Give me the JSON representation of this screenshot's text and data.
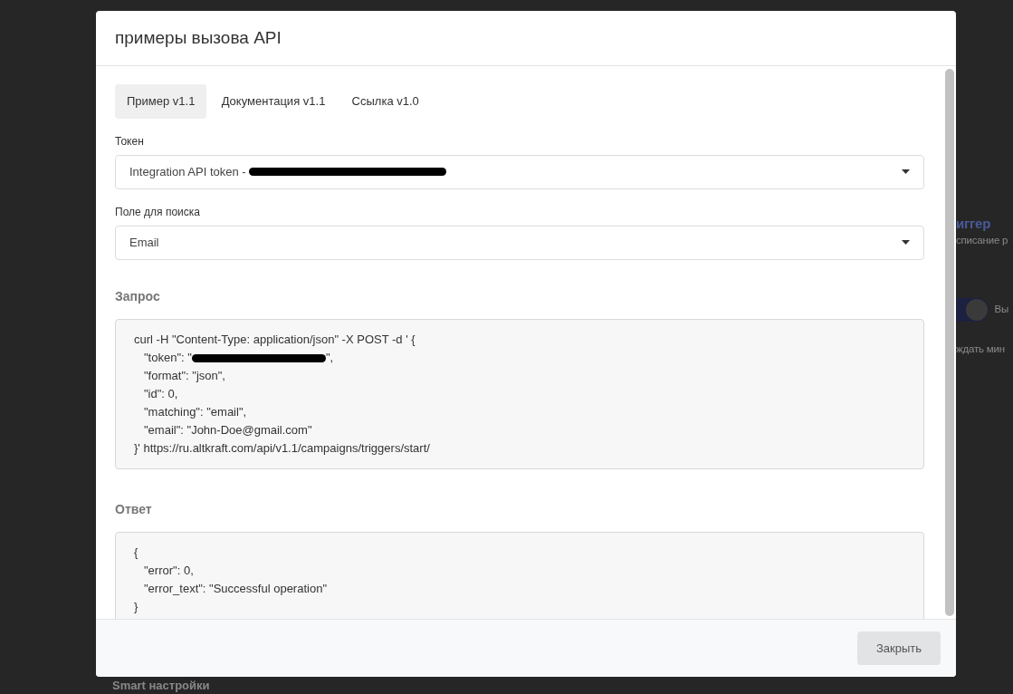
{
  "background": {
    "heading_fragment": "иггер",
    "subtitle_fragment": "списание р",
    "toggle": {
      "on": true,
      "label_fragment": "Вы"
    },
    "wait_fragment": "ждать мин",
    "section_title": "Smart настройки"
  },
  "modal": {
    "title": "примеры вызова API",
    "tabs": [
      {
        "label": "Пример v1.1",
        "selected": true
      },
      {
        "label": "Документация v1.1",
        "selected": false
      },
      {
        "label": "Ссылка v1.0",
        "selected": false
      }
    ],
    "fields": [
      {
        "label": "Токен",
        "value": "Integration API token -",
        "redacted": true
      },
      {
        "label": "Поле для поиска",
        "value": "Email",
        "redacted": false
      }
    ],
    "request": {
      "heading": "Запрос",
      "lines": [
        {
          "text": "curl -H \"Content-Type: application/json\" -X POST -d ' {",
          "indented": false,
          "redacted": false
        },
        {
          "text": "\"token\": \"",
          "indented": true,
          "redacted": true,
          "after": "\","
        },
        {
          "text": "\"format\": \"json\",",
          "indented": true,
          "redacted": false
        },
        {
          "text": "\"id\": 0,",
          "indented": true,
          "redacted": false
        },
        {
          "text": "\"matching\": \"email\",",
          "indented": true,
          "redacted": false
        },
        {
          "text": "\"email\": \"John-Doe@gmail.com\"",
          "indented": true,
          "redacted": false
        },
        {
          "text": "}' https://ru.altkraft.com/api/v1.1/campaigns/triggers/start/",
          "indented": false,
          "redacted": false
        }
      ]
    },
    "response": {
      "heading": "Ответ",
      "lines": [
        {
          "text": "{",
          "indented": false,
          "redacted": false
        },
        {
          "text": "\"error\": 0,",
          "indented": true,
          "redacted": false
        },
        {
          "text": "\"error_text\": \"Successful operation\"",
          "indented": true,
          "redacted": false
        },
        {
          "text": "}",
          "indented": false,
          "redacted": false
        }
      ]
    },
    "close_button": "Закрыть"
  }
}
